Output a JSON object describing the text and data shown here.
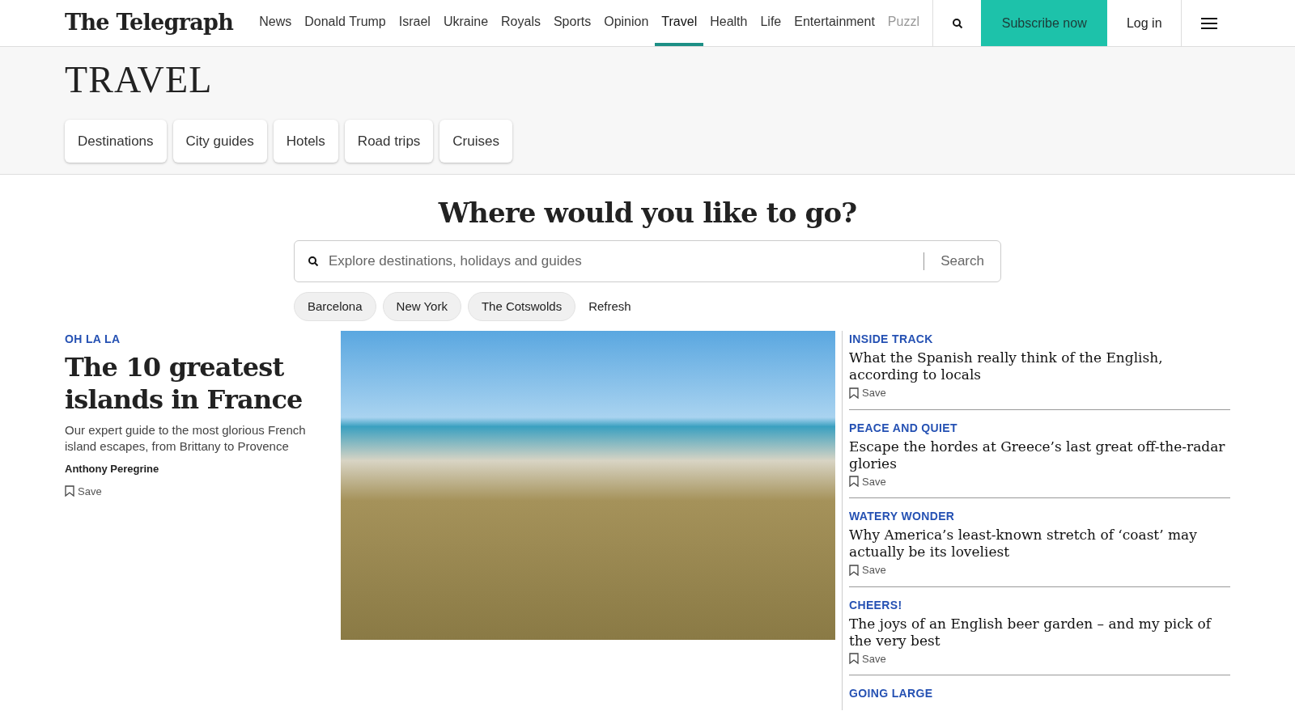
{
  "header": {
    "logo": "The Telegraph",
    "nav": [
      {
        "label": "News",
        "selected": false
      },
      {
        "label": "Donald Trump",
        "selected": false
      },
      {
        "label": "Israel",
        "selected": false
      },
      {
        "label": "Ukraine",
        "selected": false
      },
      {
        "label": "Royals",
        "selected": false
      },
      {
        "label": "Sports",
        "selected": false
      },
      {
        "label": "Opinion",
        "selected": false
      },
      {
        "label": "Travel",
        "selected": true
      },
      {
        "label": "Health",
        "selected": false
      },
      {
        "label": "Life",
        "selected": false
      },
      {
        "label": "Entertainment",
        "selected": false
      },
      {
        "label": "Puzzl",
        "selected": false
      }
    ],
    "subscribe": "Subscribe now",
    "login": "Log in"
  },
  "section": {
    "title": "TRAVEL",
    "categories": [
      "Destinations",
      "City guides",
      "Hotels",
      "Road trips",
      "Cruises"
    ]
  },
  "search": {
    "heading": "Where would you like to go?",
    "placeholder": "Explore destinations, holidays and guides",
    "button": "Search",
    "suggestions": [
      "Barcelona",
      "New York",
      "The Cotswolds"
    ],
    "refresh": "Refresh"
  },
  "lead": {
    "kicker": "OH LA LA",
    "headline": "The 10 greatest islands in France",
    "standfirst": "Our expert guide to the most glorious French island escapes, from Brittany to Provence",
    "author": "Anthony Peregrine",
    "save": "Save"
  },
  "stories": [
    {
      "kicker": "INSIDE TRACK",
      "headline": "What the Spanish really think of the English, according to locals",
      "save": "Save"
    },
    {
      "kicker": "PEACE AND QUIET",
      "headline": "Escape the hordes at Greece’s last great off-the-radar glories",
      "save": "Save"
    },
    {
      "kicker": "WATERY WONDER",
      "headline": "Why America’s least-known stretch of ‘coast’ may actually be its loveliest",
      "save": "Save"
    },
    {
      "kicker": "CHEERS!",
      "headline": "The joys of an English beer garden – and my pick of the very best",
      "save": "Save"
    },
    {
      "kicker": "GOING LARGE"
    }
  ]
}
